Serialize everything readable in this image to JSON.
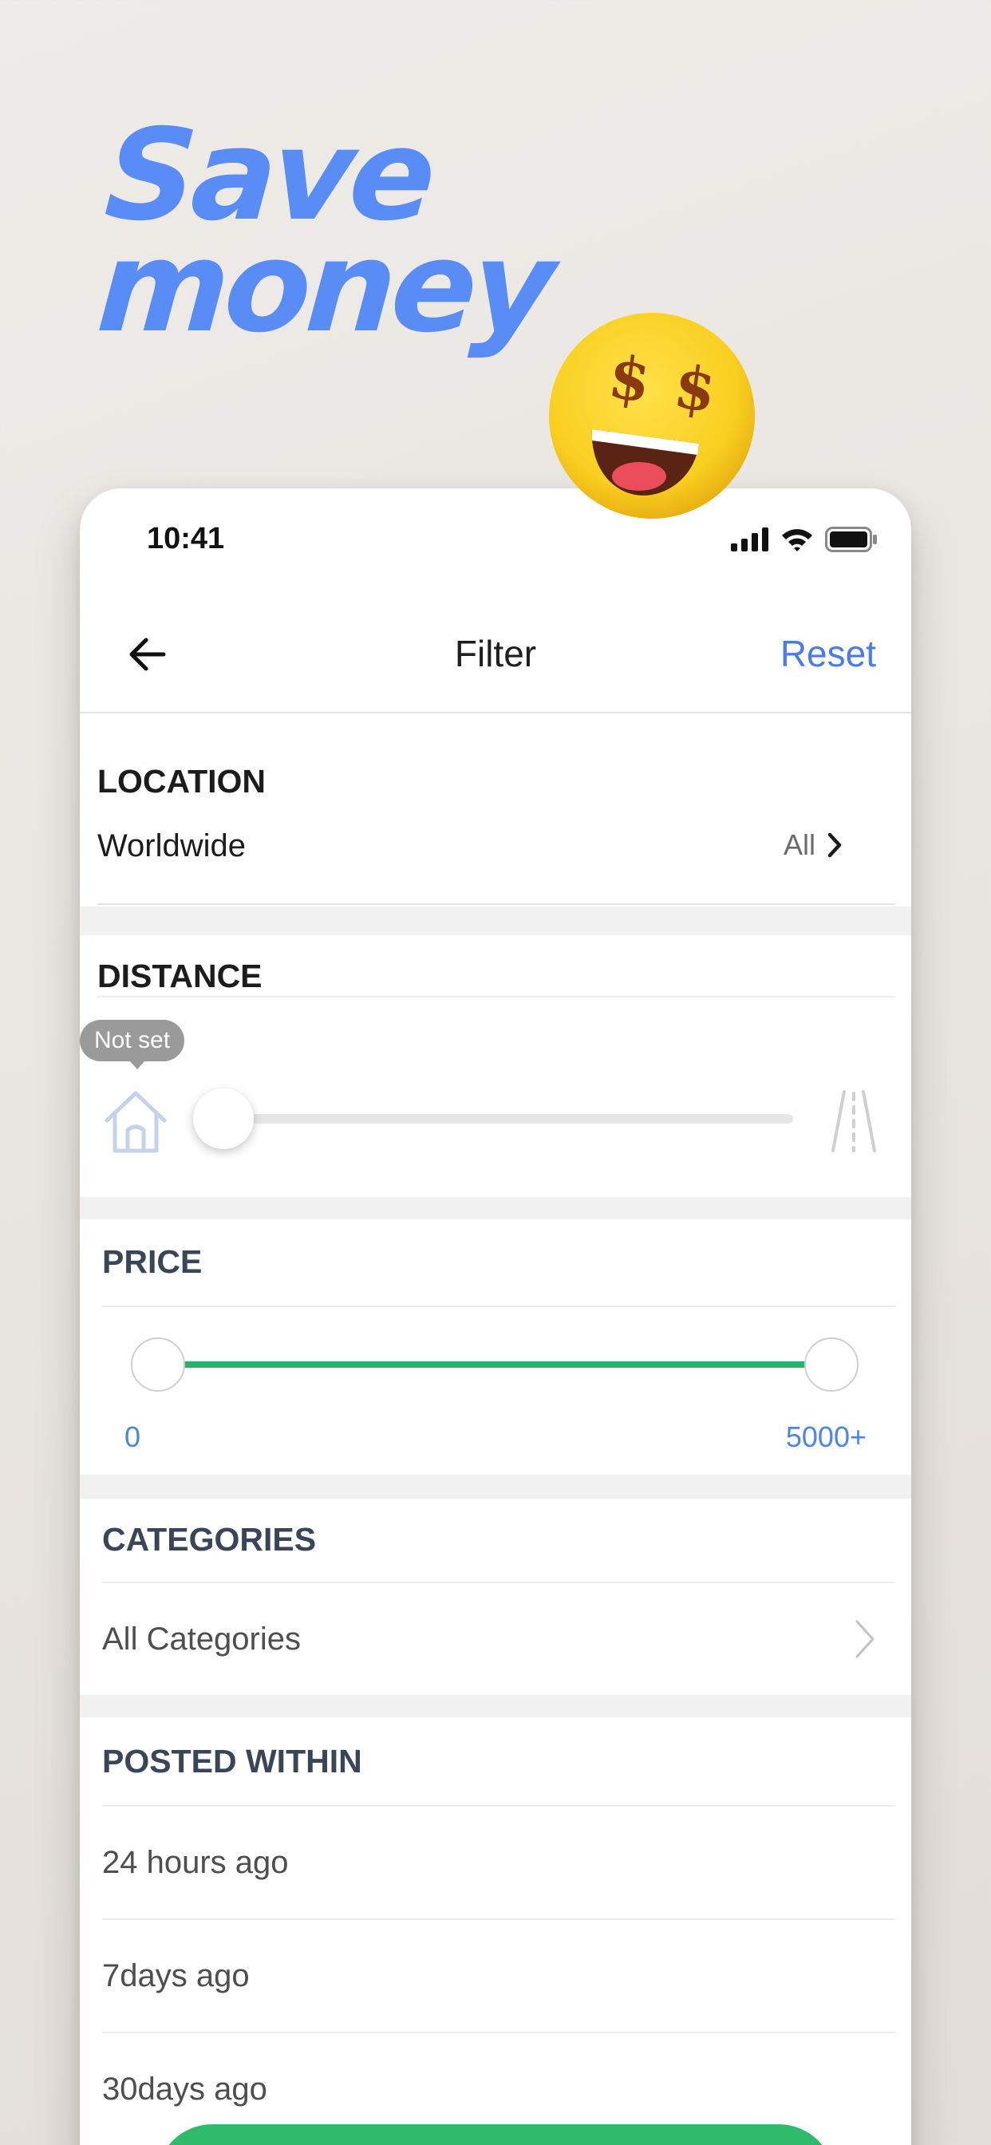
{
  "promo": {
    "line1": "Save",
    "line2": "money"
  },
  "status_bar": {
    "time": "10:41"
  },
  "nav": {
    "title": "Filter",
    "reset": "Reset"
  },
  "location": {
    "label": "LOCATION",
    "value": "Worldwide",
    "scope": "All"
  },
  "distance": {
    "label": "DISTANCE",
    "tooltip": "Not set",
    "slider_value": 0
  },
  "price": {
    "label": "PRICE",
    "min_label": "0",
    "max_label": "5000+",
    "range_fraction": [
      0,
      1
    ]
  },
  "categories": {
    "label": "CATEGORIES",
    "value": "All Categories"
  },
  "posted_within": {
    "label": "POSTED WITHIN",
    "options": [
      "24 hours ago",
      "7days ago",
      "30days ago"
    ]
  },
  "colors": {
    "accent_blue": "#4a7be8",
    "headline_blue": "#5a8cf5",
    "slider_green": "#26b36a",
    "price_value_blue": "#4a87e0"
  }
}
